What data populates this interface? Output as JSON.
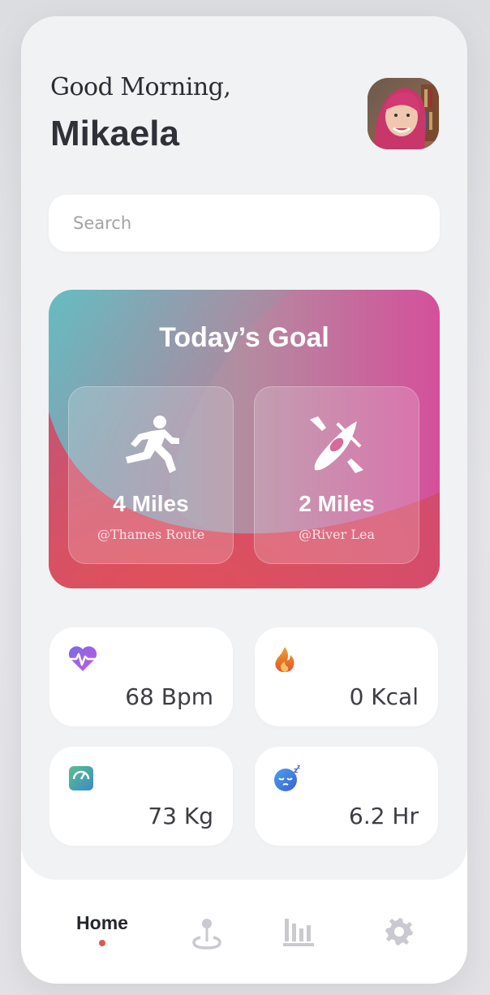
{
  "header": {
    "greeting": "Good Morning,",
    "name": "Mikaela",
    "avatar_icon": "user-avatar-photo"
  },
  "search": {
    "placeholder": "Search",
    "value": ""
  },
  "goal": {
    "title": "Today’s Goal",
    "activities": [
      {
        "icon": "running-icon",
        "value": "4 Miles",
        "location": "@Thames Route"
      },
      {
        "icon": "kayak-icon",
        "value": "2 Miles",
        "location": "@River Lea"
      }
    ],
    "colors": {
      "teal": "#5fc3c8",
      "pink": "#d84a9a",
      "red": "#d9484e"
    }
  },
  "stats": [
    {
      "icon": "heart-rate-icon",
      "value": "68 Bpm"
    },
    {
      "icon": "flame-icon",
      "value": "0 Kcal"
    },
    {
      "icon": "weight-scale-icon",
      "value": "73 Kg"
    },
    {
      "icon": "sleep-icon",
      "value": "6.2 Hr"
    }
  ],
  "nav": {
    "items": [
      {
        "label": "Home",
        "icon": "home",
        "active": true
      },
      {
        "label": "",
        "icon": "location-pin-icon",
        "active": false
      },
      {
        "label": "",
        "icon": "bar-chart-icon",
        "active": false
      },
      {
        "label": "",
        "icon": "settings-gear-icon",
        "active": false
      }
    ],
    "accent": "#e05656"
  }
}
